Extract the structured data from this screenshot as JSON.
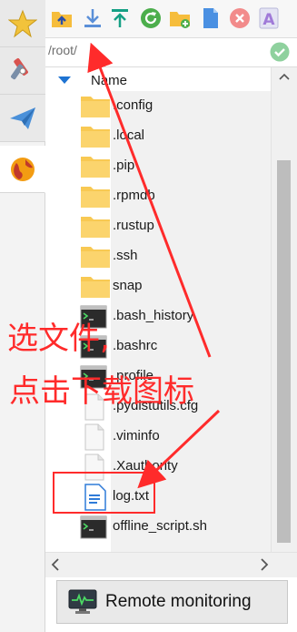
{
  "left_tabs": [
    {
      "name": "favorites",
      "icon": "star-icon"
    },
    {
      "name": "tools",
      "icon": "tools-icon"
    },
    {
      "name": "send",
      "icon": "paper-plane-icon"
    },
    {
      "name": "sftp",
      "icon": "globe-icon"
    }
  ],
  "toolbar": [
    {
      "name": "upload-folder",
      "icon": "folder-up-icon"
    },
    {
      "name": "download",
      "icon": "download-icon"
    },
    {
      "name": "upload",
      "icon": "upload-icon"
    },
    {
      "name": "refresh",
      "icon": "refresh-icon"
    },
    {
      "name": "new-folder",
      "icon": "new-folder-icon"
    },
    {
      "name": "new-file",
      "icon": "new-file-icon"
    },
    {
      "name": "delete",
      "icon": "delete-icon"
    },
    {
      "name": "rename",
      "icon": "rename-icon"
    }
  ],
  "path": {
    "value": "/root/"
  },
  "file_list": {
    "column_header": "Name",
    "items": [
      {
        "name": ".config",
        "type": "folder"
      },
      {
        "name": ".local",
        "type": "folder"
      },
      {
        "name": ".pip",
        "type": "folder"
      },
      {
        "name": ".rpmdb",
        "type": "folder"
      },
      {
        "name": ".rustup",
        "type": "folder"
      },
      {
        "name": ".ssh",
        "type": "folder"
      },
      {
        "name": "snap",
        "type": "folder"
      },
      {
        "name": ".bash_history",
        "type": "script"
      },
      {
        "name": ".bashrc",
        "type": "script"
      },
      {
        "name": ".profile",
        "type": "script"
      },
      {
        "name": ".pydistutils.cfg",
        "type": "file"
      },
      {
        "name": ".viminfo",
        "type": "file"
      },
      {
        "name": ".Xauthority",
        "type": "file"
      },
      {
        "name": "log.txt",
        "type": "text"
      },
      {
        "name": "offline_script.sh",
        "type": "script"
      }
    ]
  },
  "bottom_button": {
    "label": "Remote monitoring",
    "icon": "monitor-icon"
  },
  "annotation": {
    "line1": "选文件,",
    "line2": "点击下载图标",
    "color": "#ff2b2b"
  }
}
